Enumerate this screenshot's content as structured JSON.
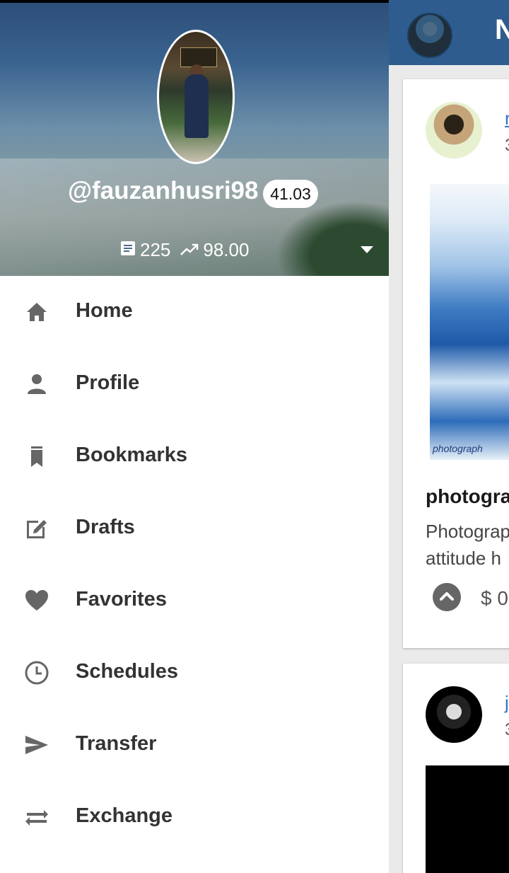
{
  "drawer": {
    "username": "@fauzanhusri98",
    "reputation": "41.03",
    "posts_count": "225",
    "voting_power": "98.00",
    "icons": {
      "posts": "document-icon",
      "voting_power": "trending-up-icon",
      "expand": "chevron-down-icon"
    },
    "menu": [
      {
        "label": "Home",
        "icon": "home-icon"
      },
      {
        "label": "Profile",
        "icon": "person-icon"
      },
      {
        "label": "Bookmarks",
        "icon": "bookmark-icon"
      },
      {
        "label": "Drafts",
        "icon": "edit-icon"
      },
      {
        "label": "Favorites",
        "icon": "heart-icon"
      },
      {
        "label": "Schedules",
        "icon": "clock-icon"
      },
      {
        "label": "Transfer",
        "icon": "send-icon"
      },
      {
        "label": "Exchange",
        "icon": "swap-icon"
      }
    ]
  },
  "feed": {
    "header_title_fragment": "N",
    "cards": [
      {
        "author_fragment": "r",
        "meta_fragment": "3",
        "image_watermark": "photograph",
        "title_fragment": "photogra",
        "desc_line1": "Photograp",
        "desc_line2": "attitude h",
        "amount_fragment": "$ 0"
      },
      {
        "author_fragment": "j",
        "meta_fragment": "3"
      }
    ]
  },
  "colors": {
    "topbar": "#2f5c8e",
    "link": "#2b78c6",
    "menu_text": "#333333",
    "menu_icon": "#666666"
  }
}
